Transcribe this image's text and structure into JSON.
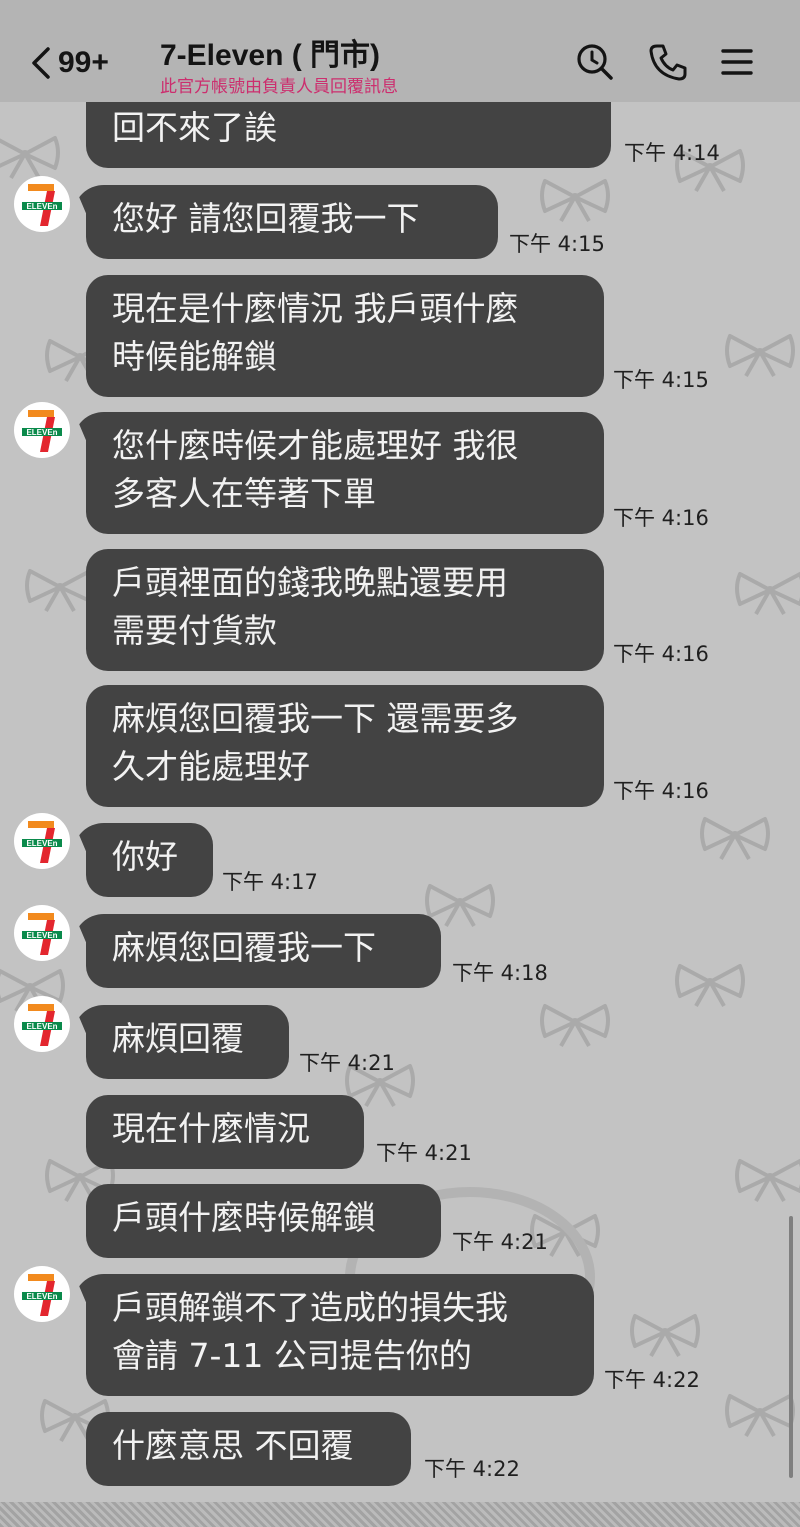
{
  "header": {
    "back_count": "99+",
    "title": "7-Eleven (      門市)",
    "subtitle": "此官方帳號由負責人員回覆訊息"
  },
  "avatar_brand": {
    "seven": "7",
    "eleven": "ELEVEn",
    "colors": {
      "green": "#0a8a4b",
      "orange": "#f28a1e",
      "red": "#e3262e"
    }
  },
  "messages": [
    {
      "lines": [
        "回不來了誒"
      ],
      "time": "下午 4:14"
    },
    {
      "lines": [
        "您好 請您回覆我一下"
      ],
      "time": "下午 4:15"
    },
    {
      "lines": [
        "現在是什麼情況 我戶頭什麼",
        "時候能解鎖"
      ],
      "time": "下午 4:15"
    },
    {
      "lines": [
        "您什麼時候才能處理好 我很",
        "多客人在等著下單"
      ],
      "time": "下午 4:16"
    },
    {
      "lines": [
        "戶頭裡面的錢我晚點還要用",
        "需要付貨款"
      ],
      "time": "下午 4:16"
    },
    {
      "lines": [
        "麻煩您回覆我一下 還需要多",
        "久才能處理好"
      ],
      "time": "下午 4:16"
    },
    {
      "lines": [
        "你好"
      ],
      "time": "下午 4:17"
    },
    {
      "lines": [
        "麻煩您回覆我一下"
      ],
      "time": "下午 4:18"
    },
    {
      "lines": [
        "麻煩回覆"
      ],
      "time": "下午 4:21"
    },
    {
      "lines": [
        "現在什麼情況"
      ],
      "time": "下午 4:21"
    },
    {
      "lines": [
        "戶頭什麼時候解鎖"
      ],
      "time": "下午 4:21"
    },
    {
      "lines": [
        "戶頭解鎖不了造成的損失我",
        "會請 7-11 公司提告你的"
      ],
      "time": "下午 4:22"
    },
    {
      "lines": [
        "什麼意思 不回覆"
      ],
      "time": "下午 4:22"
    }
  ],
  "icons": {
    "back": "chevron-left-icon",
    "search": "search-icon",
    "call": "phone-icon",
    "menu": "hamburger-menu-icon"
  },
  "colors": {
    "header_bg": "#b4b4b4",
    "chat_bg": "#c3c3c3",
    "bubble_bg": "#434343",
    "bubble_text": "#f2f2f2",
    "subtitle": "#cc2e6e"
  }
}
